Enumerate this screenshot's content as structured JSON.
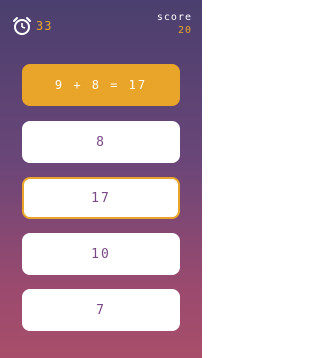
{
  "colors": {
    "accent": "#e8a52a",
    "answer_text": "#7a4a86",
    "question_text": "#ffffff",
    "timer_text": "#e8a52a",
    "score_label_text": "#ffffff",
    "score_value_text": "#e8a52a"
  },
  "header": {
    "timer_icon": "alarm-clock-icon",
    "timer_value": "33",
    "score_label": "score",
    "score_value": "20"
  },
  "question": {
    "text": "9 + 8 = 17"
  },
  "answers": [
    {
      "label": "8",
      "selected": false
    },
    {
      "label": "17",
      "selected": true
    },
    {
      "label": "10",
      "selected": false
    },
    {
      "label": "7",
      "selected": false
    }
  ]
}
